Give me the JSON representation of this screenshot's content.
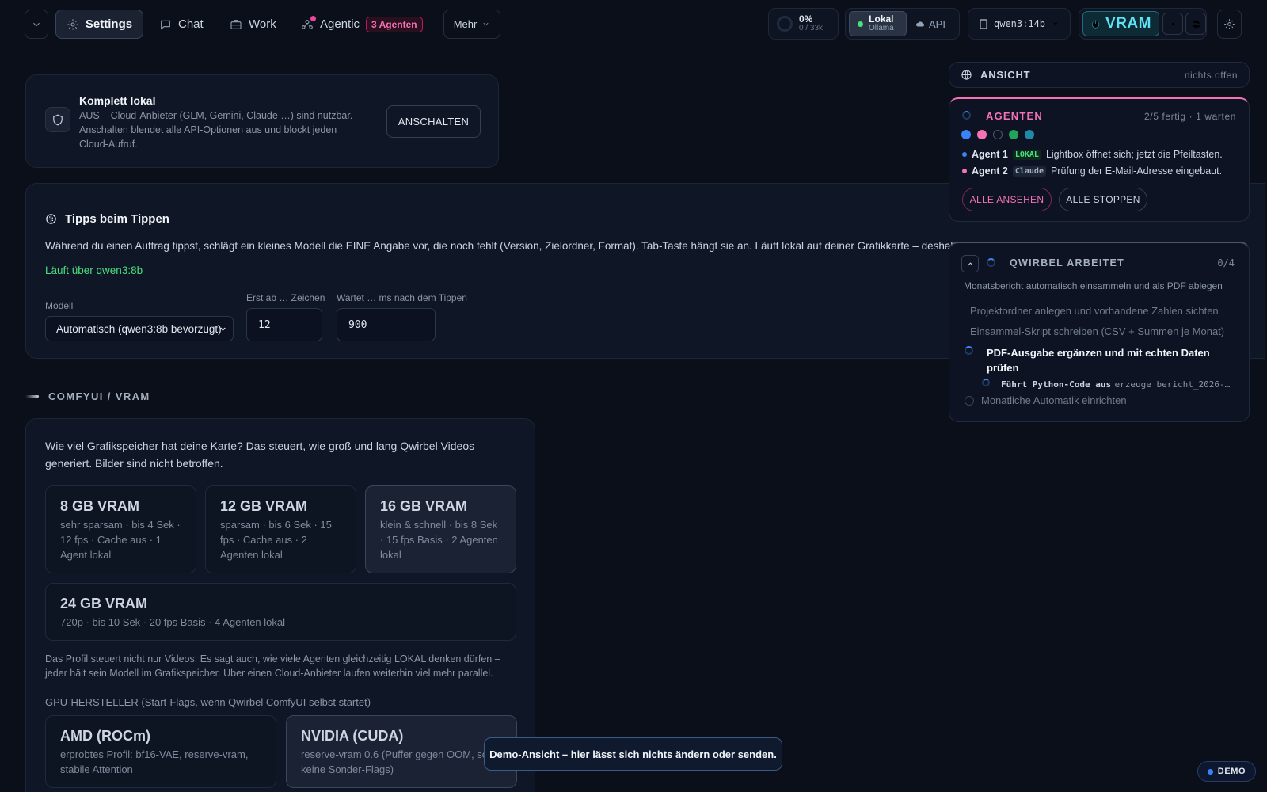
{
  "topbar": {
    "settings_label": "Settings",
    "chat_label": "Chat",
    "work_label": "Work",
    "agentic_label": "Agentic",
    "agentic_badge": "3 Agenten",
    "more_label": "Mehr",
    "context_percent": "0%",
    "context_tokens": "0 / 33k",
    "mode_local_label": "Lokal",
    "mode_local_sub": "Ollama",
    "mode_api_label": "API",
    "model_label": "qwen3:14b",
    "vram_label": "VRAM"
  },
  "local_card": {
    "title": "Komplett lokal",
    "description": "AUS – Cloud-Anbieter (GLM, Gemini, Claude …) sind nutzbar. Anschalten blendet alle API-Optionen aus und blockt jeden Cloud-Aufruf.",
    "button_label": "ANSCHALTEN"
  },
  "tips_card": {
    "title": "Tipps beim Tippen",
    "description": "Während du einen Auftrag tippst, schlägt ein kleines Modell die EINE Angabe vor, die noch fehlt (Version, Zielordner, Format). Tab-Taste hängt sie an. Läuft lokal auf deiner Grafikkarte – deshal",
    "status": "Läuft über qwen3:8b",
    "model_label": "Modell",
    "model_value": "Automatisch (qwen3:8b bevorzugt)",
    "min_chars_label": "Erst ab … Zeichen",
    "min_chars_value": "12",
    "wait_label": "Wartet … ms nach dem Tippen",
    "wait_value": "900"
  },
  "comfy_section": {
    "heading": "COMFYUI / VRAM",
    "intro": "Wie viel Grafikspeicher hat deine Karte? Das steuert, wie groß und lang Qwirbel Videos generiert. Bilder sind nicht betroffen.",
    "vram_options": [
      {
        "title": "8 GB VRAM",
        "desc": "sehr sparsam · bis 4 Sek · 12 fps · Cache aus · 1 Agent lokal"
      },
      {
        "title": "12 GB VRAM",
        "desc": "sparsam · bis 6 Sek · 15 fps · Cache aus · 2 Agenten lokal"
      },
      {
        "title": "16 GB VRAM",
        "desc": "klein & schnell · bis 8 Sek · 15 fps Basis · 2 Agenten lokal"
      },
      {
        "title": "24 GB VRAM",
        "desc": "720p · bis 10 Sek · 20 fps Basis · 4 Agenten lokal"
      }
    ],
    "selected_option": "16 GB VRAM",
    "profile_note": "Das Profil steuert nicht nur Videos: Es sagt auch, wie viele Agenten gleichzeitig LOKAL denken dürfen – jeder hält sein Modell im Grafikspeicher. Über einen Cloud-Anbieter laufen weiterhin viel mehr parallel.",
    "gpu_heading": "GPU-HERSTELLER (Start-Flags, wenn Qwirbel ComfyUI selbst startet)",
    "gpu_options": [
      {
        "title": "AMD (ROCm)",
        "desc": "erprobtes Profil: bf16-VAE, reserve-vram, stabile Attention"
      },
      {
        "title": "NVIDIA (CUDA)",
        "desc": "reserve-vram 0.6 (Puffer gegen OOM, sonst keine Sonder-Flags)"
      }
    ],
    "selected_gpu": "NVIDIA (CUDA)"
  },
  "view_panel": {
    "title": "ANSICHT",
    "status": "nichts offen"
  },
  "agents_panel": {
    "title": "AGENTEN",
    "status": "2/5 fertig · 1 warten",
    "dot_colors": [
      "#3b82f6",
      "#f472b6",
      "transparent",
      "#22a35a",
      "#1f8aa8"
    ],
    "agents": [
      {
        "name": "Agent 1",
        "tag": "LOKAL",
        "text": "Lightbox öffnet sich; jetzt die Pfeiltasten.",
        "color": "#3b82f6"
      },
      {
        "name": "Agent 2",
        "tag": "Claude",
        "text": "Prüfung der E-Mail-Adresse eingebaut.",
        "color": "#f472b6"
      }
    ],
    "view_all_label": "ALLE ANSEHEN",
    "stop_all_label": "ALLE STOPPEN"
  },
  "task_panel": {
    "title": "QWIRBEL ARBEITET",
    "progress": "0/4",
    "goal": "Monatsbericht automatisch einsammeln und als PDF ablegen",
    "steps": [
      {
        "text": "Projektordner anlegen und vorhandene Zahlen sichten",
        "state": "done"
      },
      {
        "text": "Einsammel-Skript schreiben (CSV + Summen je Monat)",
        "state": "done"
      },
      {
        "text": "PDF-Ausgabe ergänzen und mit echten Daten prüfen",
        "state": "active"
      },
      {
        "text": "Monatliche Automatik einrichten",
        "state": "pending"
      }
    ],
    "sub_action": "Führt Python-Code aus",
    "sub_detail": "erzeuge bericht_2026-…"
  },
  "toast": {
    "text": "Demo-Ansicht – hier lässt sich nichts ändern oder senden."
  },
  "demo_badge": "DEMO",
  "colors": {
    "background": "#0a0f1a",
    "accent_pink": "#f472b6",
    "accent_cyan": "#22d3ee",
    "status_green": "#4ade80"
  }
}
